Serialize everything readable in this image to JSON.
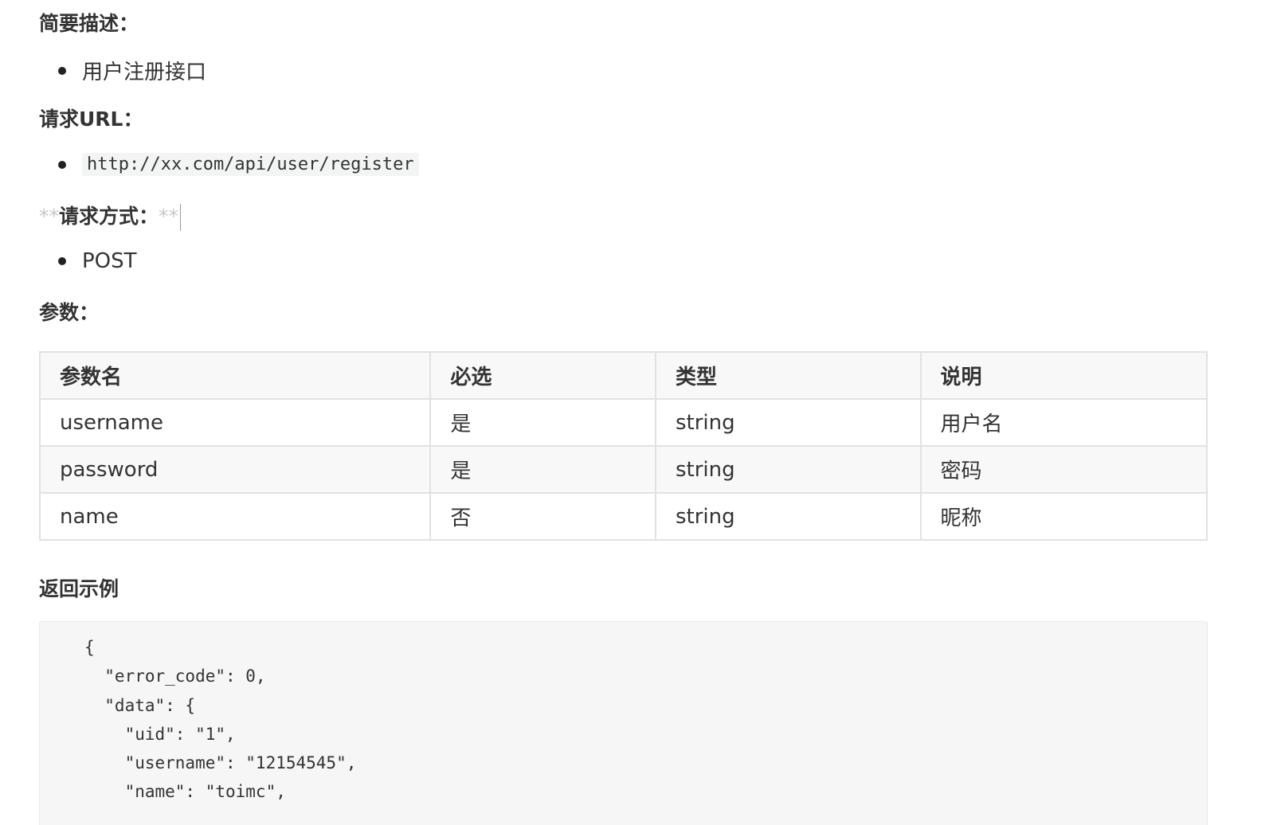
{
  "sections": {
    "description": {
      "heading": "简要描述：",
      "items": [
        "用户注册接口"
      ]
    },
    "url": {
      "heading": "请求URL：",
      "items": [
        "http://xx.com/api/user/register"
      ]
    },
    "method": {
      "marker_open": "**",
      "heading": "请求方式：",
      "marker_close": "**",
      "items": [
        "POST"
      ]
    },
    "params": {
      "heading": "参数："
    },
    "response": {
      "heading": "返回示例"
    }
  },
  "table": {
    "headers": [
      "参数名",
      "必选",
      "类型",
      "说明"
    ],
    "rows": [
      [
        "username",
        "是",
        "string",
        "用户名"
      ],
      [
        "password",
        "是",
        "string",
        "密码"
      ],
      [
        "name",
        "否",
        "string",
        "昵称"
      ]
    ]
  },
  "code": {
    "lines": [
      "{",
      "  \"error_code\": 0,",
      "  \"data\": {",
      "    \"uid\": \"1\",",
      "    \"username\": \"12154545\",",
      "    \"name\": \"toimc\","
    ]
  }
}
